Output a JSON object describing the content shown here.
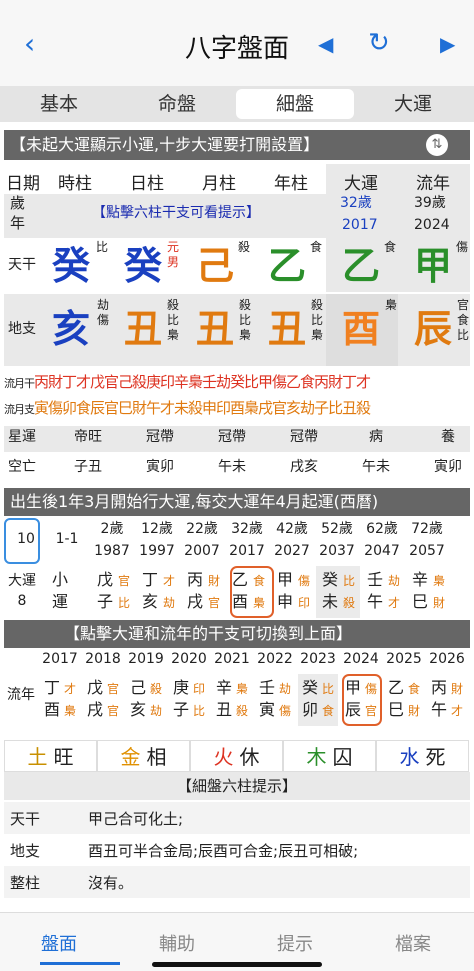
{
  "header": {
    "title": "八字盤面",
    "back_icon": "chevron-left",
    "prev_icon": "triangle-left",
    "refresh_icon": "refresh",
    "next_icon": "triangle-right"
  },
  "tabs": [
    "基本",
    "命盤",
    "細盤",
    "大運"
  ],
  "notice": "【未起大運顯示小運,十步大運要打開設置】",
  "cols": [
    "日期",
    "時柱",
    "日柱",
    "月柱",
    "年柱",
    "大運",
    "流年"
  ],
  "age_row": {
    "label1": "歲",
    "label2": "年",
    "hint": "【點擊六柱干支可看提示】",
    "dayun_age": "32歲",
    "dayun_year": "2017",
    "liunian_age": "39歲",
    "liunian_year": "2024"
  },
  "tiangan": {
    "label": "天干",
    "stems": [
      "癸",
      "癸",
      "己",
      "乙",
      "乙",
      "甲"
    ],
    "tags": [
      "比",
      "元男",
      "殺",
      "食",
      "食",
      "傷"
    ]
  },
  "dizhi": {
    "label": "地支",
    "branches": [
      "亥",
      "丑",
      "丑",
      "丑",
      "酉",
      "辰"
    ],
    "tags": [
      "劫傷",
      "殺比梟",
      "殺比梟",
      "殺比梟",
      "梟",
      "官食比"
    ]
  },
  "liuyue": {
    "label": "流月干",
    "row": "丙財丁才戊官己殺庚印辛梟壬劫癸比甲傷乙食丙財丁才"
  },
  "liuyuezhi": {
    "label": "流月支",
    "row": "寅傷卯食辰官巳財午才未殺申印酉梟戌官亥劫子比丑殺"
  },
  "xingyun": {
    "label": "星運",
    "values": [
      "帝旺",
      "冠帶",
      "冠帶",
      "冠帶",
      "病",
      "養"
    ]
  },
  "kongwang": {
    "label": "空亡",
    "values": [
      "子丑",
      "寅卯",
      "午未",
      "戌亥",
      "午未",
      "寅卯"
    ]
  },
  "dayun_bar": "出生後1年3月開始行大運,每交大運年4月起運(西曆)",
  "dayun_ages": [
    {
      "a": "10",
      "y": ""
    },
    {
      "a": "1-1",
      "y": ""
    },
    {
      "a": "2歲",
      "y": "1987"
    },
    {
      "a": "12歲",
      "y": "1997"
    },
    {
      "a": "22歲",
      "y": "2007"
    },
    {
      "a": "32歲",
      "y": "2017"
    },
    {
      "a": "42歲",
      "y": "2027"
    },
    {
      "a": "52歲",
      "y": "2037"
    },
    {
      "a": "62歲",
      "y": "2047"
    },
    {
      "a": "72歲",
      "y": "2057"
    }
  ],
  "dayun_label": [
    "大運",
    "8"
  ],
  "dayun_cells": [
    [
      "小",
      "運",
      "",
      ""
    ],
    [
      "戊",
      "子",
      "官",
      "比"
    ],
    [
      "丁",
      "亥",
      "才",
      "劫"
    ],
    [
      "丙",
      "戌",
      "財",
      "官"
    ],
    [
      "乙",
      "酉",
      "食",
      "梟"
    ],
    [
      "甲",
      "申",
      "傷",
      "印"
    ],
    [
      "癸",
      "未",
      "比",
      "殺"
    ],
    [
      "壬",
      "午",
      "劫",
      "才"
    ],
    [
      "辛",
      "巳",
      "梟",
      "財"
    ]
  ],
  "liunian_bar": "【點擊大運和流年的干支可切換到上面】",
  "liunian_years": [
    "2017",
    "2018",
    "2019",
    "2020",
    "2021",
    "2022",
    "2023",
    "2024",
    "2025",
    "2026"
  ],
  "liunian_label": "流年",
  "liunian_cells": [
    [
      "丁",
      "酉",
      "才",
      "梟"
    ],
    [
      "戊",
      "戌",
      "官",
      "官"
    ],
    [
      "己",
      "亥",
      "殺",
      "劫"
    ],
    [
      "庚",
      "子",
      "印",
      "比"
    ],
    [
      "辛",
      "丑",
      "梟",
      "殺"
    ],
    [
      "壬",
      "寅",
      "劫",
      "傷"
    ],
    [
      "癸",
      "卯",
      "比",
      "食"
    ],
    [
      "甲",
      "辰",
      "傷",
      "官"
    ],
    [
      "乙",
      "巳",
      "食",
      "財"
    ],
    [
      "丙",
      "午",
      "財",
      "才"
    ]
  ],
  "elements": [
    [
      "土",
      "旺"
    ],
    [
      "金",
      "相"
    ],
    [
      "火",
      "休"
    ],
    [
      "木",
      "囚"
    ],
    [
      "水",
      "死"
    ]
  ],
  "tips_title": "【細盤六柱提示】",
  "tips": [
    {
      "k": "天干",
      "v": "甲己合可化土;"
    },
    {
      "k": "地支",
      "v": "酉丑可半合金局;辰酉可合金;辰丑可相破;"
    },
    {
      "k": "整柱",
      "v": "沒有。"
    }
  ],
  "bottom_tabs": [
    "盤面",
    "輔助",
    "提示",
    "檔案"
  ]
}
